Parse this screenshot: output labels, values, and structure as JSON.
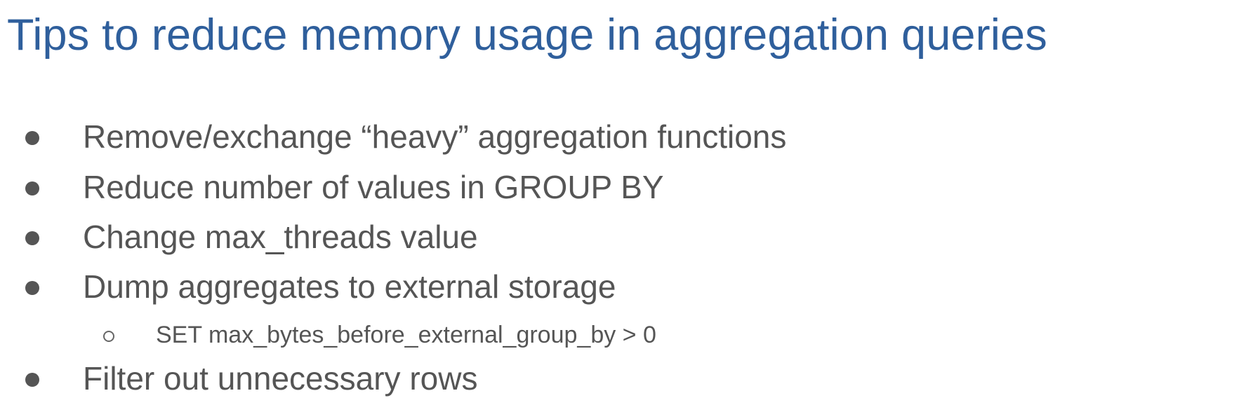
{
  "slide": {
    "title": "Tips to reduce memory usage in aggregation queries",
    "bullets": [
      {
        "text": "Remove/exchange “heavy” aggregation functions"
      },
      {
        "text": "Reduce number of values in GROUP BY"
      },
      {
        "text": "Change max_threads value"
      },
      {
        "text": "Dump aggregates to external storage",
        "subitems": [
          {
            "text": "SET max_bytes_before_external_group_by > 0"
          }
        ]
      },
      {
        "text": "Filter out unnecessary rows"
      }
    ]
  },
  "colors": {
    "title": "#2f5f9c",
    "body_text": "#555555",
    "background": "#ffffff"
  },
  "icons": {
    "bullet": "filled-circle",
    "sub_bullet": "hollow-circle"
  }
}
